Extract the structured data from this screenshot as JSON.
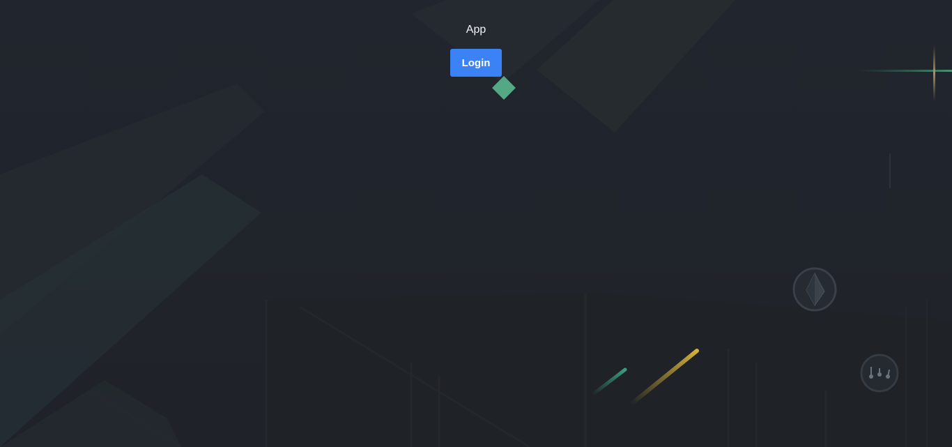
{
  "app": {
    "title": "App",
    "login_label": "Login"
  },
  "colors": {
    "background": "#21252d",
    "button": "#3b82f6",
    "accent_green": "#55a884",
    "accent_gold": "#d4b13a",
    "accent_teal": "#3b9e7e"
  },
  "decorations": {
    "icons": [
      "diamond-icon",
      "eth-coin-icon",
      "dots-coin-icon"
    ]
  }
}
